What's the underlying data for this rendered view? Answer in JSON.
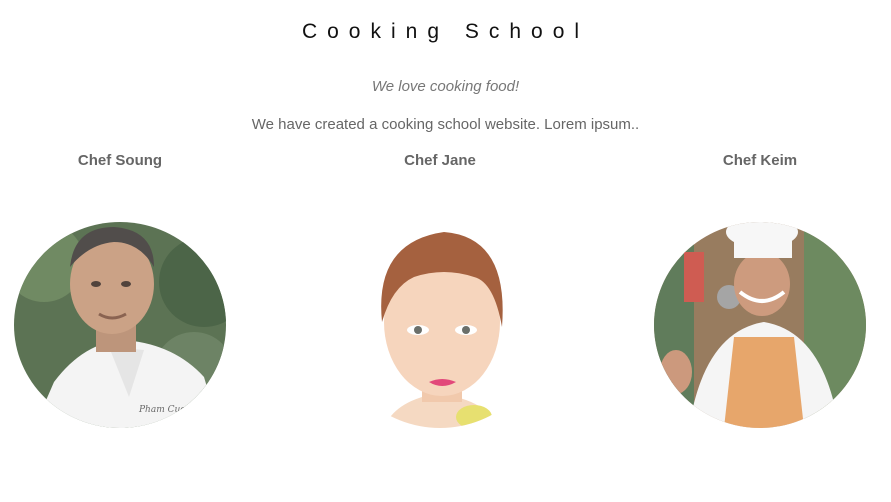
{
  "header": {
    "title": "Cooking School",
    "tagline": "We love cooking food!",
    "intro": "We have created a cooking school website. Lorem ipsum.."
  },
  "chefs": [
    {
      "name": "Chef Soung",
      "photo_icon": "chef-soung-photo"
    },
    {
      "name": "Chef Jane",
      "photo_icon": "chef-jane-photo"
    },
    {
      "name": "Chef Keim",
      "photo_icon": "chef-keim-photo"
    }
  ],
  "colors": {
    "title": "#111111",
    "text": "#666666",
    "apron": "#e49a57",
    "chef_coat": "#f4f4f4",
    "foliage": "#3d5a36"
  }
}
